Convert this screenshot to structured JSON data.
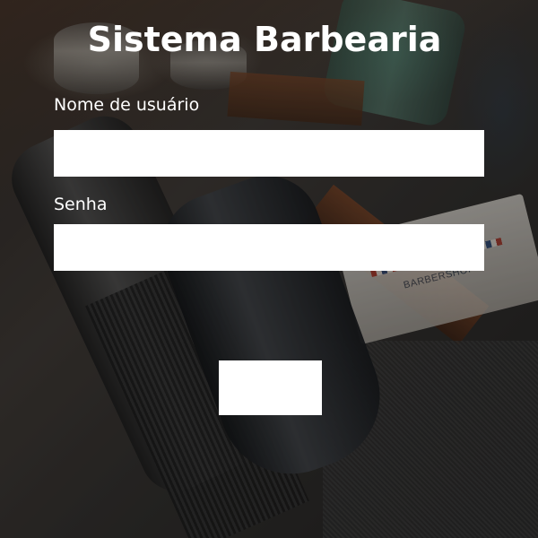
{
  "header": {
    "title": "Sistema Barbearia"
  },
  "form": {
    "username": {
      "label": "Nome de usuário",
      "value": "",
      "placeholder": ""
    },
    "password": {
      "label": "Senha",
      "value": "",
      "placeholder": ""
    },
    "submit": {
      "label": ""
    }
  },
  "background": {
    "card_text": "BARBERSHOP"
  },
  "colors": {
    "text": "#ffffff",
    "field_background": "#ffffff"
  }
}
